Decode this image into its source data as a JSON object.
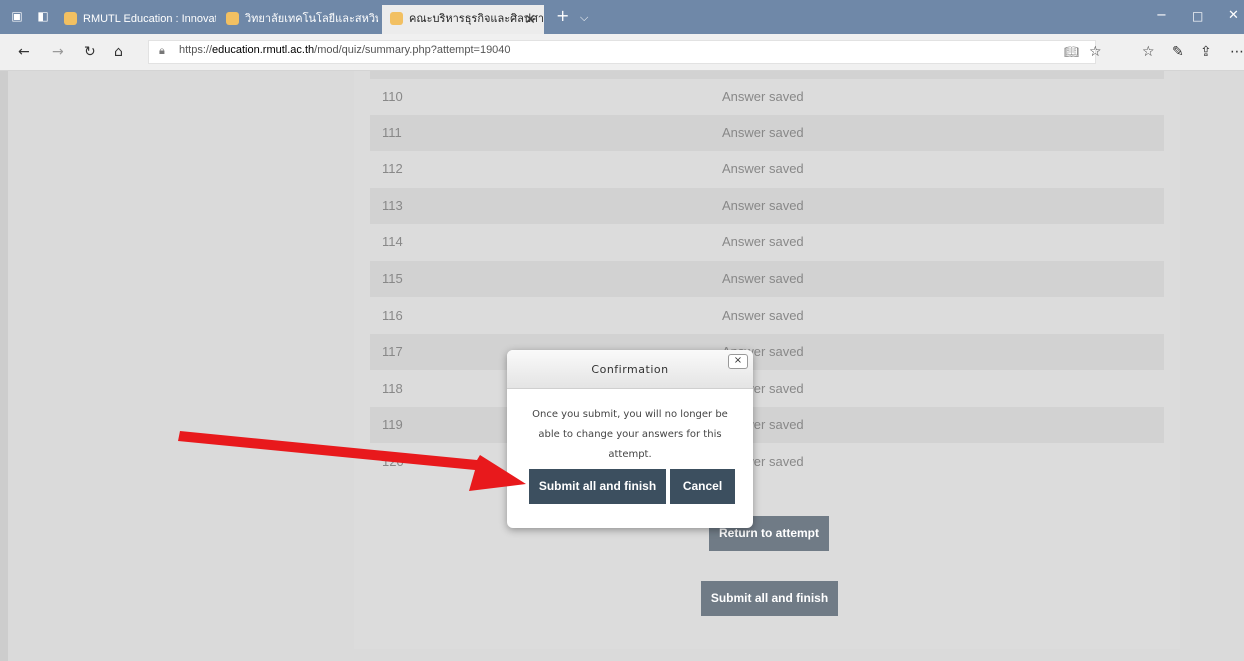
{
  "browser": {
    "tabs": [
      {
        "title": "RMUTL Education : Innovati",
        "active": false
      },
      {
        "title": "วิทยาลัยเทคโนโลยีและสหวิทยาการ",
        "active": false
      },
      {
        "title": "คณะบริหารธุรกิจและศิลปศา",
        "active": true
      }
    ],
    "url_prefix": "https://",
    "url_domain": "education.rmutl.ac.th",
    "url_path": "/mod/quiz/summary.php?attempt=19040"
  },
  "summary": {
    "rows": [
      {
        "num": "110",
        "status": "Answer saved"
      },
      {
        "num": "111",
        "status": "Answer saved"
      },
      {
        "num": "112",
        "status": "Answer saved"
      },
      {
        "num": "113",
        "status": "Answer saved"
      },
      {
        "num": "114",
        "status": "Answer saved"
      },
      {
        "num": "115",
        "status": "Answer saved"
      },
      {
        "num": "116",
        "status": "Answer saved"
      },
      {
        "num": "117",
        "status": "Answer saved"
      },
      {
        "num": "118",
        "status": "Answer saved"
      },
      {
        "num": "119",
        "status": "Answer saved"
      },
      {
        "num": "120",
        "status": "Answer saved"
      }
    ],
    "return_button": "Return to attempt",
    "submit_button": "Submit all and finish"
  },
  "dialog": {
    "title": "Confirmation",
    "close": "×",
    "message": "Once you submit, you will no longer be able to change your answers for this attempt.",
    "submit_button": "Submit all and finish",
    "cancel_button": "Cancel"
  },
  "annotation": {
    "arrow_color": "#e8191c"
  }
}
